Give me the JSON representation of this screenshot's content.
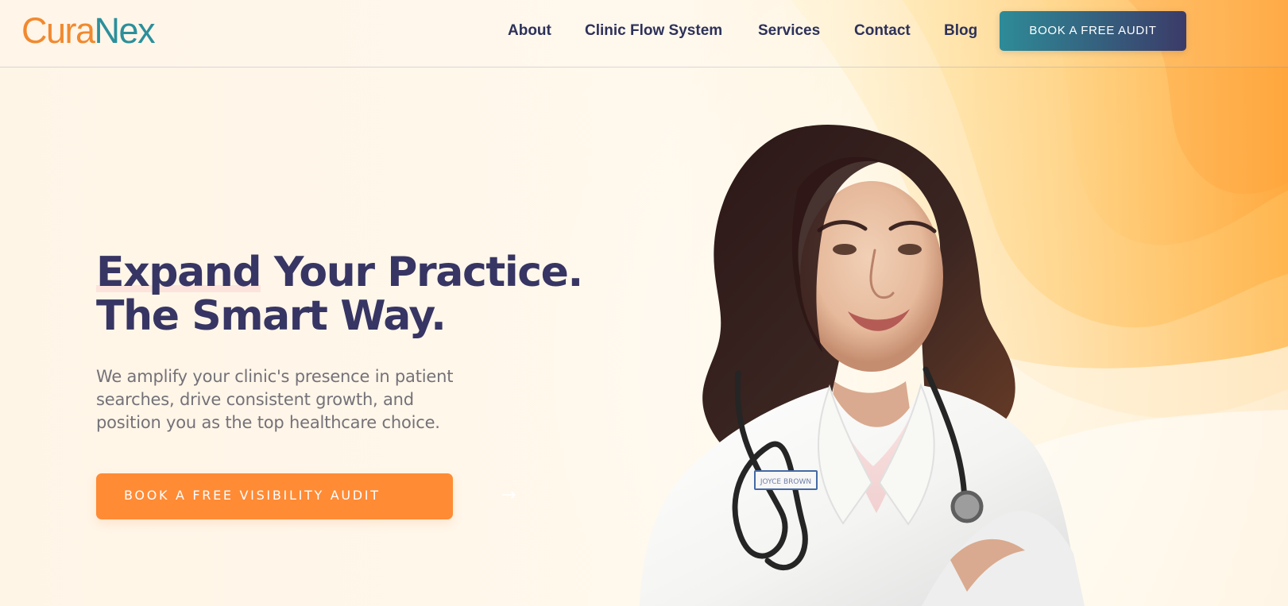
{
  "brand": {
    "logo_part_1": "Cura",
    "logo_part_2": "Nex",
    "colors": {
      "orange": "#f1892f",
      "teal": "#2c8f9b",
      "navy": "#373563"
    }
  },
  "header": {
    "nav": [
      {
        "label": "About"
      },
      {
        "label": "Clinic Flow System"
      },
      {
        "label": "Services"
      },
      {
        "label": "Contact"
      },
      {
        "label": "Blog"
      }
    ],
    "cta_label": "BOOK A FREE AUDIT"
  },
  "hero": {
    "title_highlight": "Expand",
    "title_line_1_rest": " Your Practice.",
    "title_line_2": "The Smart Way.",
    "description": "We amplify your clinic's presence in patient searches, drive consistent growth, and position you as the top healthcare choice.",
    "cta_label": "BOOK A FREE VISIBILITY AUDIT",
    "cta_icon": "arrow-right-icon",
    "cta_color": "#ff8b35"
  },
  "image": {
    "subject": "doctor-portrait",
    "badge_text": "JOYCE BROWN"
  },
  "icons": {
    "arrow": "→"
  }
}
